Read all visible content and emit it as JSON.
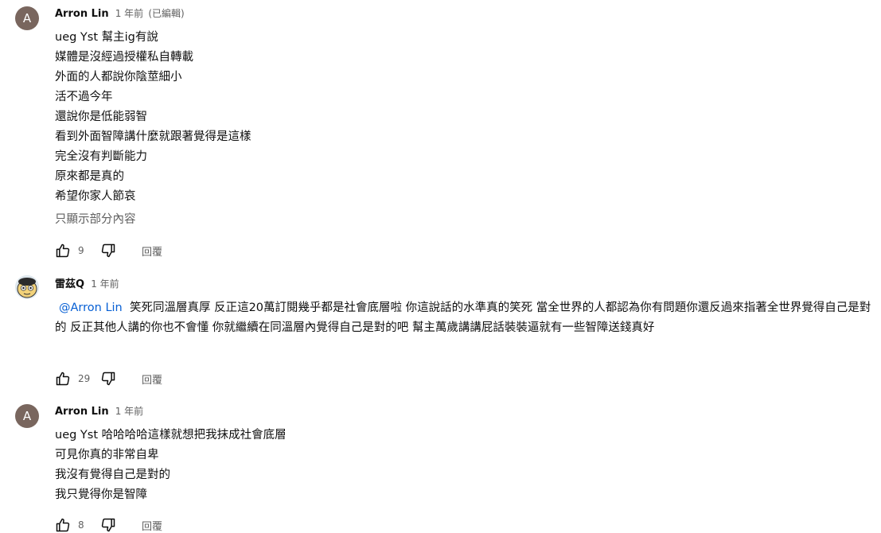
{
  "comments": [
    {
      "author": "Arron Lin",
      "time": "1 年前",
      "edited": "(已編輯)",
      "avatar_letter": "A",
      "lines": [
        "ueg Yst 幫主ig有說",
        "媒體是沒經過授權私自轉載",
        "外面的人都說你陰莖細小",
        "活不過今年",
        "還說你是低能弱智",
        "看到外面智障講什麼就跟著覺得是這樣",
        "完全沒有判斷能力",
        "原來都是真的",
        "希望你家人節哀"
      ],
      "read_more": "只顯示部分內容",
      "likes": "9",
      "reply": "回覆"
    },
    {
      "author": "雷茲Q",
      "time": "1 年前",
      "mention": "@Arron Lin",
      "text": "笑死同溫層真厚 反正這20萬訂閱幾乎都是社會底層啦 你這說話的水準真的笑死 當全世界的人都認為你有問題你還反過來指著全世界覺得自己是對的 反正其他人講的你也不會懂 你就繼續在同溫層內覺得自己是對的吧 幫主萬歲講講屁話裝裝逼就有一些智障送錢真好",
      "likes": "29",
      "reply": "回覆"
    },
    {
      "author": "Arron Lin",
      "time": "1 年前",
      "avatar_letter": "A",
      "lines": [
        "ueg Yst 哈哈哈哈這樣就想把我抹成社會底層",
        "可見你真的非常自卑",
        "我沒有覺得自己是對的",
        "我只覺得你是智障"
      ],
      "likes": "8",
      "reply": "回覆"
    }
  ],
  "icons": {
    "like": "thumb-up-icon",
    "dislike": "thumb-down-icon"
  }
}
